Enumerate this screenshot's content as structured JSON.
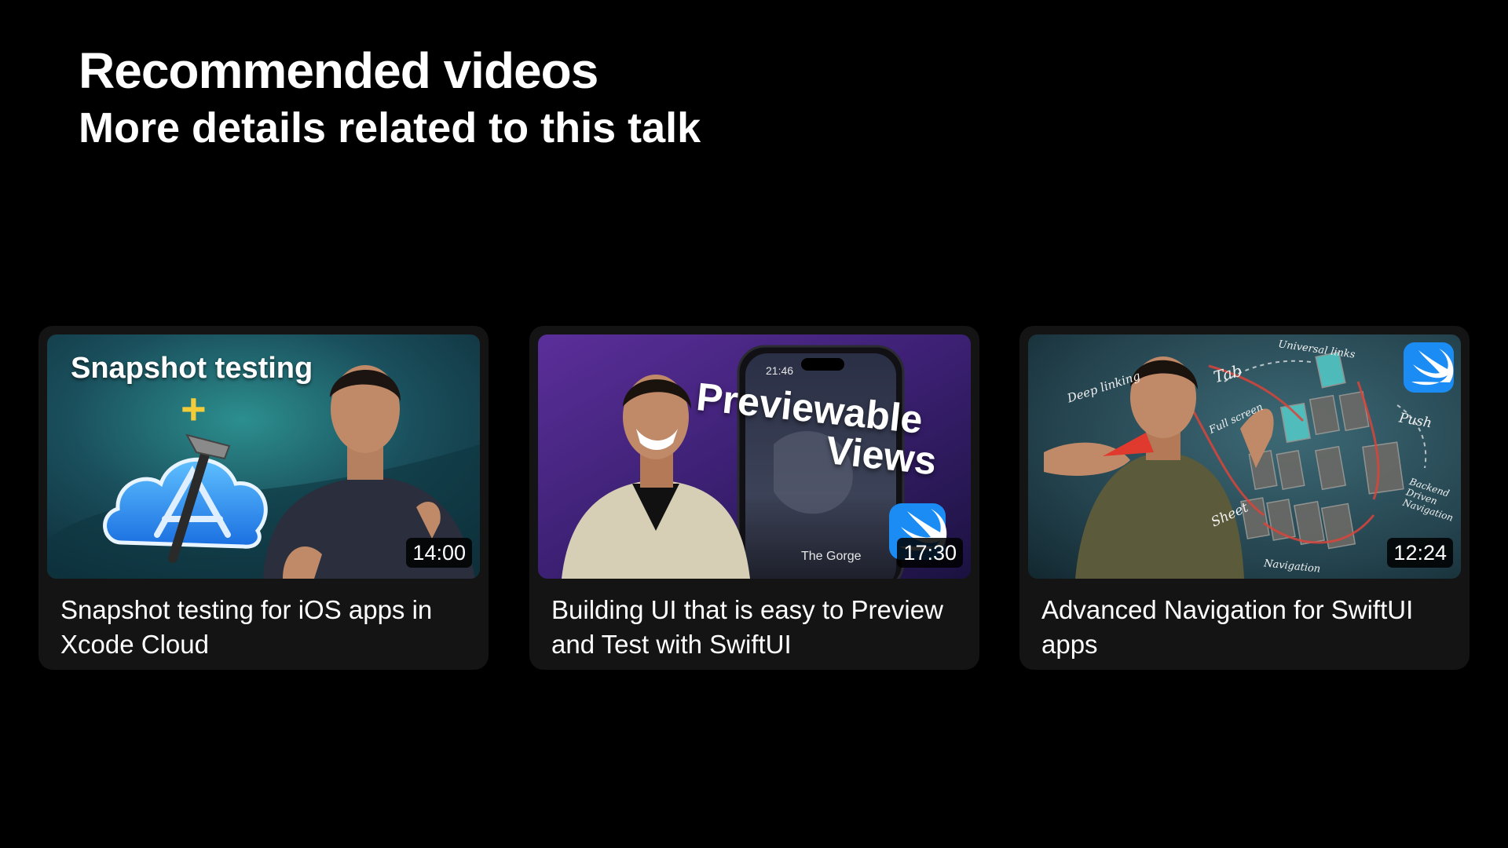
{
  "header": {
    "title": "Recommended videos",
    "subtitle": "More details related to this talk"
  },
  "videos": [
    {
      "title": "Snapshot testing for iOS apps in Xcode Cloud",
      "duration": "14:00",
      "thumbnail_text": {
        "headline": "Snapshot testing",
        "plus": "+"
      }
    },
    {
      "title": "Building UI that is easy to Preview and Test with SwiftUI",
      "duration": "17:30",
      "thumbnail_text": {
        "line1": "Previewable",
        "line2": "Views",
        "phone_time": "21:46",
        "phone_movie": "The Gorge"
      }
    },
    {
      "title": "Advanced Navigation for SwiftUI apps",
      "duration": "12:24",
      "thumbnail_text": {
        "deep_linking": "Deep linking",
        "tab": "Tab",
        "universal_links": "Universal links",
        "full_screen": "Full screen",
        "push": "Push",
        "sheet": "Sheet",
        "backend_driven": "Backend Driven Navigation",
        "navigation": "Navigation"
      }
    }
  ]
}
